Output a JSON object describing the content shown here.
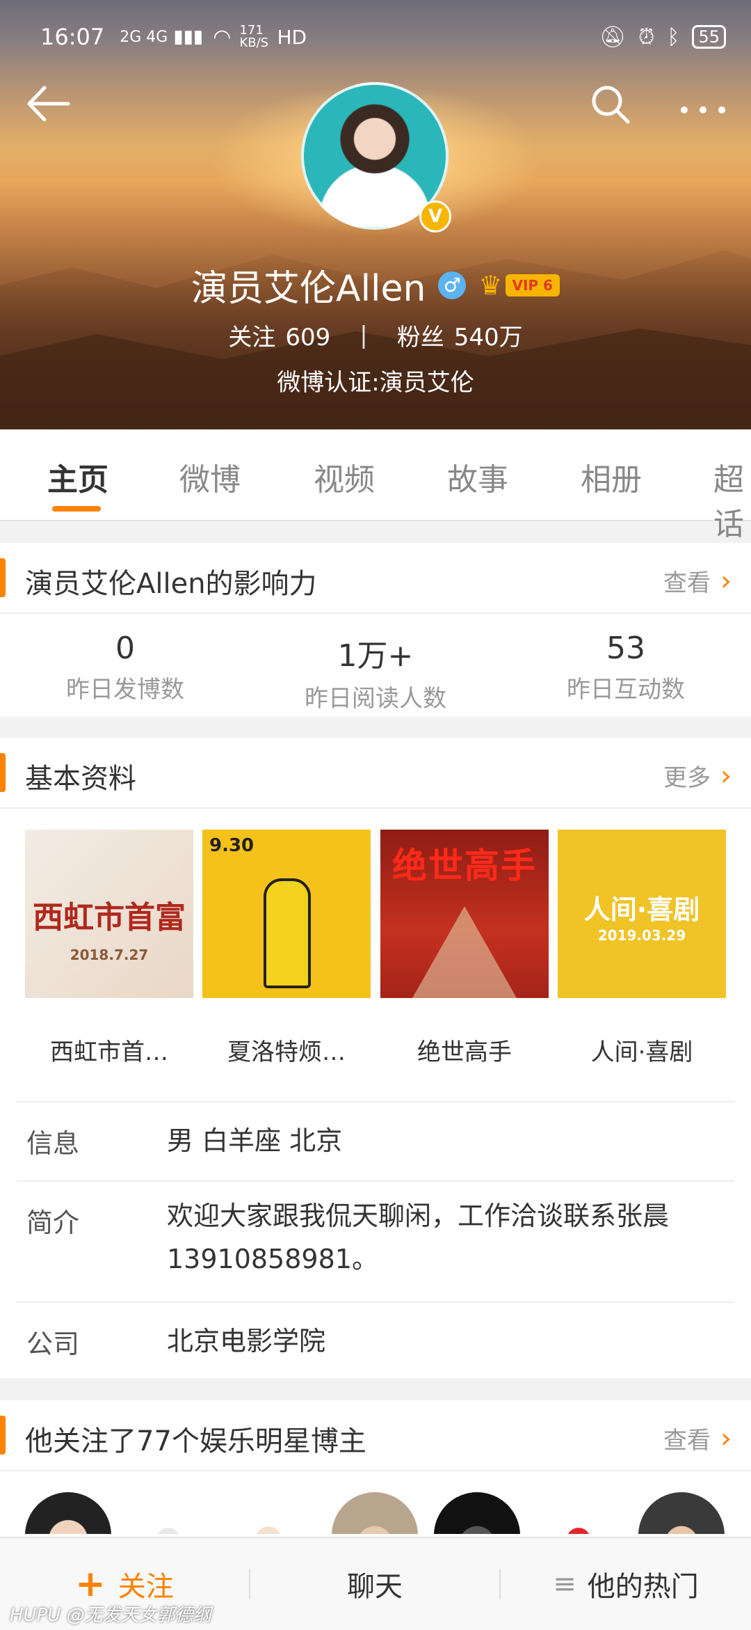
{
  "status_bar": {
    "time": "16:07",
    "network": "2G 4G",
    "speed": "171 KB/S",
    "hd": "HD",
    "battery": "55"
  },
  "header": {
    "back_icon": "back-arrow-icon",
    "search_icon": "search-icon",
    "more_icon": "more-dots-icon"
  },
  "profile": {
    "name": "演员艾伦Allen",
    "verified_badge": "V",
    "gender_symbol": "♂",
    "vip_label": "VIP 6",
    "following_label": "关注",
    "following_count": "609",
    "followers_label": "粉丝",
    "followers_count": "540万",
    "verification": "微博认证:演员艾伦"
  },
  "tabs": [
    "主页",
    "微博",
    "视频",
    "故事",
    "相册",
    "超话"
  ],
  "influence": {
    "title": "演员艾伦Allen的影响力",
    "more": "查看",
    "stats": [
      {
        "value": "0",
        "label": "昨日发博数"
      },
      {
        "value": "1万+",
        "label": "昨日阅读人数"
      },
      {
        "value": "53",
        "label": "昨日互动数"
      }
    ]
  },
  "basic_info": {
    "title": "基本资料",
    "more": "更多",
    "works": [
      {
        "title": "西虹市首…",
        "poster_text": "西虹市首富",
        "poster_sub": "2018.7.27"
      },
      {
        "title": "夏洛特烦…",
        "poster_text": "9.30",
        "poster_sub": ""
      },
      {
        "title": "绝世高手",
        "poster_text": "绝世高手",
        "poster_sub": ""
      },
      {
        "title": "人间·喜剧",
        "poster_text": "人间·喜剧",
        "poster_sub": "2019.03.29"
      }
    ],
    "rows": [
      {
        "key": "信息",
        "value": "男 白羊座 北京"
      },
      {
        "key": "简介",
        "value": "欢迎大家跟我侃天聊闲，工作洽谈联系张晨13910858981。"
      },
      {
        "key": "公司",
        "value": "北京电影学院"
      }
    ]
  },
  "following_stars": {
    "title": "他关注了77个娱乐明星博主",
    "more": "查看"
  },
  "bottom_bar": {
    "follow": "关注",
    "follow_icon": "+",
    "chat": "聊天",
    "hot": "他的热门",
    "hot_icon": "≡"
  },
  "watermark": {
    "brand": "HUPU",
    "text": "@无发天女郭德纲"
  },
  "colors": {
    "accent": "#ff8200",
    "gold": "#f7b500",
    "gender_blue": "#5cb3f2"
  }
}
